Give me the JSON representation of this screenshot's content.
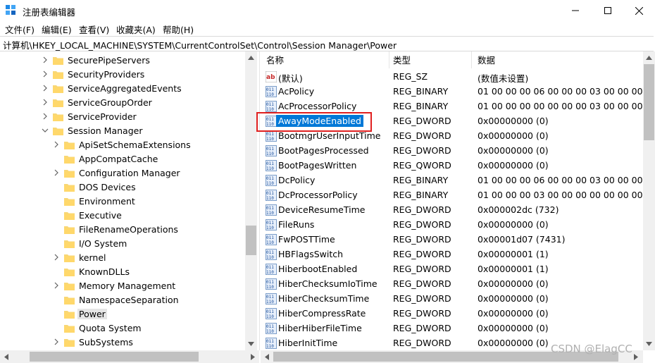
{
  "window": {
    "title": "注册表编辑器",
    "minimize_icon": "minimize-icon",
    "maximize_icon": "maximize-icon",
    "close_icon": "close-icon"
  },
  "menu": [
    "文件(F)",
    "编辑(E)",
    "查看(V)",
    "收藏夹(A)",
    "帮助(H)"
  ],
  "address": "计算机\\HKEY_LOCAL_MACHINE\\SYSTEM\\CurrentControlSet\\Control\\Session Manager\\Power",
  "tree": {
    "items": [
      {
        "label": "SecurePipeServers",
        "level": 0,
        "expandable": true,
        "expanded": false,
        "selected": false
      },
      {
        "label": "SecurityProviders",
        "level": 0,
        "expandable": true,
        "expanded": false,
        "selected": false
      },
      {
        "label": "ServiceAggregatedEvents",
        "level": 0,
        "expandable": true,
        "expanded": false,
        "selected": false
      },
      {
        "label": "ServiceGroupOrder",
        "level": 0,
        "expandable": true,
        "expanded": false,
        "selected": false
      },
      {
        "label": "ServiceProvider",
        "level": 0,
        "expandable": true,
        "expanded": false,
        "selected": false
      },
      {
        "label": "Session Manager",
        "level": 0,
        "expandable": true,
        "expanded": true,
        "selected": false
      },
      {
        "label": "ApiSetSchemaExtensions",
        "level": 1,
        "expandable": true,
        "expanded": false,
        "selected": false
      },
      {
        "label": "AppCompatCache",
        "level": 1,
        "expandable": false,
        "expanded": false,
        "selected": false
      },
      {
        "label": "Configuration Manager",
        "level": 1,
        "expandable": true,
        "expanded": false,
        "selected": false
      },
      {
        "label": "DOS Devices",
        "level": 1,
        "expandable": false,
        "expanded": false,
        "selected": false
      },
      {
        "label": "Environment",
        "level": 1,
        "expandable": false,
        "expanded": false,
        "selected": false
      },
      {
        "label": "Executive",
        "level": 1,
        "expandable": false,
        "expanded": false,
        "selected": false
      },
      {
        "label": "FileRenameOperations",
        "level": 1,
        "expandable": false,
        "expanded": false,
        "selected": false
      },
      {
        "label": "I/O System",
        "level": 1,
        "expandable": false,
        "expanded": false,
        "selected": false
      },
      {
        "label": "kernel",
        "level": 1,
        "expandable": true,
        "expanded": false,
        "selected": false
      },
      {
        "label": "KnownDLLs",
        "level": 1,
        "expandable": false,
        "expanded": false,
        "selected": false
      },
      {
        "label": "Memory Management",
        "level": 1,
        "expandable": true,
        "expanded": false,
        "selected": false
      },
      {
        "label": "NamespaceSeparation",
        "level": 1,
        "expandable": false,
        "expanded": false,
        "selected": false
      },
      {
        "label": "Power",
        "level": 1,
        "expandable": false,
        "expanded": false,
        "selected": true
      },
      {
        "label": "Quota System",
        "level": 1,
        "expandable": false,
        "expanded": false,
        "selected": false
      },
      {
        "label": "SubSystems",
        "level": 1,
        "expandable": true,
        "expanded": false,
        "selected": false
      }
    ]
  },
  "list": {
    "columns": [
      "名称",
      "类型",
      "数据"
    ],
    "rows": [
      {
        "name": "(默认)",
        "type": "REG_SZ",
        "data": "(数值未设置)",
        "icon": "string-value-icon",
        "selected": false
      },
      {
        "name": "AcPolicy",
        "type": "REG_BINARY",
        "data": "01 00 00 00 06 00 00 00 03 00 00 00 00 00",
        "icon": "binary-value-icon",
        "selected": false
      },
      {
        "name": "AcProcessorPolicy",
        "type": "REG_BINARY",
        "data": "01 00 00 00 00 00 00 00 03 00 00 00 00 03",
        "icon": "binary-value-icon",
        "selected": false
      },
      {
        "name": "AwayModeEnabled",
        "type": "REG_DWORD",
        "data": "0x00000000 (0)",
        "icon": "binary-value-icon",
        "selected": true
      },
      {
        "name": "BootmgrUserInputTime",
        "type": "REG_DWORD",
        "data": "0x00000000 (0)",
        "icon": "binary-value-icon",
        "selected": false
      },
      {
        "name": "BootPagesProcessed",
        "type": "REG_DWORD",
        "data": "0x00000000 (0)",
        "icon": "binary-value-icon",
        "selected": false
      },
      {
        "name": "BootPagesWritten",
        "type": "REG_QWORD",
        "data": "0x00000000 (0)",
        "icon": "binary-value-icon",
        "selected": false
      },
      {
        "name": "DcPolicy",
        "type": "REG_BINARY",
        "data": "01 00 00 00 06 00 00 00 03 00 00 00 00 00",
        "icon": "binary-value-icon",
        "selected": false
      },
      {
        "name": "DcProcessorPolicy",
        "type": "REG_BINARY",
        "data": "01 00 00 00 03 00 00 00 00 00 00 00 00 03",
        "icon": "binary-value-icon",
        "selected": false
      },
      {
        "name": "DeviceResumeTime",
        "type": "REG_DWORD",
        "data": "0x000002dc (732)",
        "icon": "binary-value-icon",
        "selected": false
      },
      {
        "name": "FileRuns",
        "type": "REG_DWORD",
        "data": "0x00000000 (0)",
        "icon": "binary-value-icon",
        "selected": false
      },
      {
        "name": "FwPOSTTime",
        "type": "REG_DWORD",
        "data": "0x00001d07 (7431)",
        "icon": "binary-value-icon",
        "selected": false
      },
      {
        "name": "HBFlagsSwitch",
        "type": "REG_DWORD",
        "data": "0x00000001 (1)",
        "icon": "binary-value-icon",
        "selected": false
      },
      {
        "name": "HiberbootEnabled",
        "type": "REG_DWORD",
        "data": "0x00000001 (1)",
        "icon": "binary-value-icon",
        "selected": false
      },
      {
        "name": "HiberChecksumIoTime",
        "type": "REG_DWORD",
        "data": "0x00000000 (0)",
        "icon": "binary-value-icon",
        "selected": false
      },
      {
        "name": "HiberChecksumTime",
        "type": "REG_DWORD",
        "data": "0x00000000 (0)",
        "icon": "binary-value-icon",
        "selected": false
      },
      {
        "name": "HiberCompressRate",
        "type": "REG_DWORD",
        "data": "0x00000000 (0)",
        "icon": "binary-value-icon",
        "selected": false
      },
      {
        "name": "HiberHiberFileTime",
        "type": "REG_DWORD",
        "data": "0x00000000 (0)",
        "icon": "binary-value-icon",
        "selected": false
      },
      {
        "name": "HiberInitTime",
        "type": "REG_DWORD",
        "data": "0x00000000 (0)",
        "icon": "binary-value-icon",
        "selected": false
      }
    ]
  },
  "watermark": "CSDN @ElagCC",
  "colors": {
    "selection": "#0078d7",
    "annotation_box": "#e02020",
    "folder": "#f8d775"
  }
}
